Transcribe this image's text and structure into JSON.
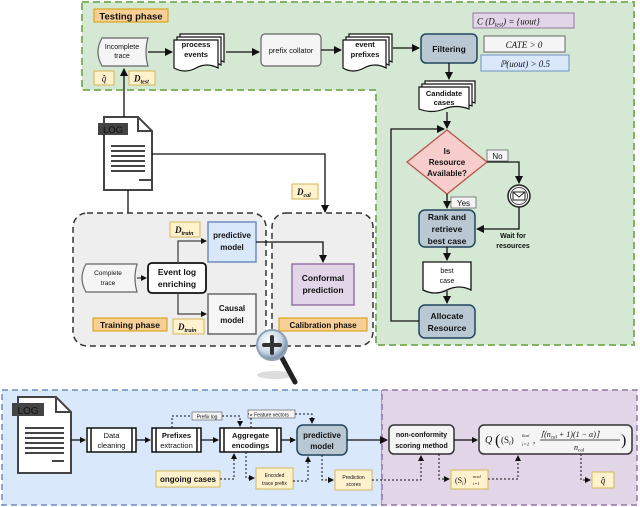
{
  "colors": {
    "testing_bg": "#d5e8d4",
    "testing_border": "#82b366",
    "training_bg": "#eeeeee",
    "training_border": "#333333",
    "bottom_left_bg": "#dae8fc",
    "bottom_left_border": "#6c8ebf",
    "bottom_right_bg": "#e1d5e7",
    "bottom_right_border": "#9673a6",
    "phase_label_bg": "#f8cf96",
    "phase_label_border": "#d79b00",
    "note_bg": "#fff2cc",
    "note_border": "#d6b656",
    "decision_bg": "#f8cecc",
    "decision_border": "#b85450",
    "process_bg": "#bac8d3",
    "process_border": "#23445d",
    "predictive_bg": "#dae8fc",
    "predictive_border": "#6c8ebf",
    "conformal_bg": "#e1d5e7",
    "conformal_border": "#9673a6"
  },
  "testing": {
    "label": "Testing phase",
    "incomplete_trace": [
      "Incomplete",
      "trace"
    ],
    "process_events": [
      "process",
      "events"
    ],
    "prefix_collator": "prefix collator",
    "event_prefixes": [
      "event",
      "prefixes"
    ],
    "filtering": "Filtering",
    "candidate_cases": [
      "Candidate",
      "cases"
    ],
    "decision": [
      "Is",
      "Resource",
      "Available?"
    ],
    "no_label": "No",
    "yes_label": "Yes",
    "wait_label": [
      "Wait for",
      "resources"
    ],
    "rank": [
      "Rank and",
      "retrieve",
      "best case"
    ],
    "best_case": [
      "best",
      "case"
    ],
    "allocate": [
      "Allocate",
      "Resource"
    ],
    "q_hat": "q̂",
    "d_test": "D",
    "d_test_sub": "test",
    "conformal_set": "C (D",
    "conformal_set_sub": "test",
    "conformal_set_rest": ") = {uout}",
    "cate_condition": "CATE > 0",
    "prob_condition": "ℙ(uout) > 0.5"
  },
  "log_label": "LOG",
  "d_cal": "D",
  "d_cal_sub": "cal",
  "training": {
    "label": "Training phase",
    "complete_trace": [
      "Complete",
      "trace"
    ],
    "enriching": [
      "Event log",
      "enriching"
    ],
    "predictive_model": [
      "predictive",
      "model"
    ],
    "causal_model": [
      "Causal",
      "model"
    ],
    "d_train": "D",
    "d_train_sub": "train"
  },
  "calibration": {
    "label": "Calibration phase",
    "conformal": [
      "Conformal",
      "prediction"
    ]
  },
  "pipeline": {
    "log_label": "LOG",
    "data_cleaning": [
      "Data",
      "cleaning"
    ],
    "prefixes_extraction": [
      "Prefixes",
      "extraction"
    ],
    "aggregate_encodings": [
      "Aggregate",
      "encodings"
    ],
    "predictive_model": [
      "predictive",
      "model"
    ],
    "prefix_log": "Prefix log",
    "feature_vectors": "Feature vectors",
    "ongoing_cases": "ongoing cases",
    "encoded_trace_prefix": [
      "Encoded",
      "trace prefix"
    ],
    "prediction_scores": [
      "Prediction",
      "scores"
    ],
    "nonconformity": [
      "non-conformity",
      "scoring method"
    ],
    "scores_set": "(S",
    "scores_set_sub": "i",
    "scores_set_close": ")",
    "scores_set_range": "i=1",
    "scores_set_sup": "n",
    "scores_set_supsub": "cal",
    "quantile_q": "Q",
    "quantile_numerator": "⌈(n",
    "quantile_num_sub": "cal",
    "quantile_num_rest": " + 1)(1 − α)⌉",
    "quantile_denominator": "n",
    "quantile_den_sub": "cal",
    "q_hat": "q̂"
  }
}
